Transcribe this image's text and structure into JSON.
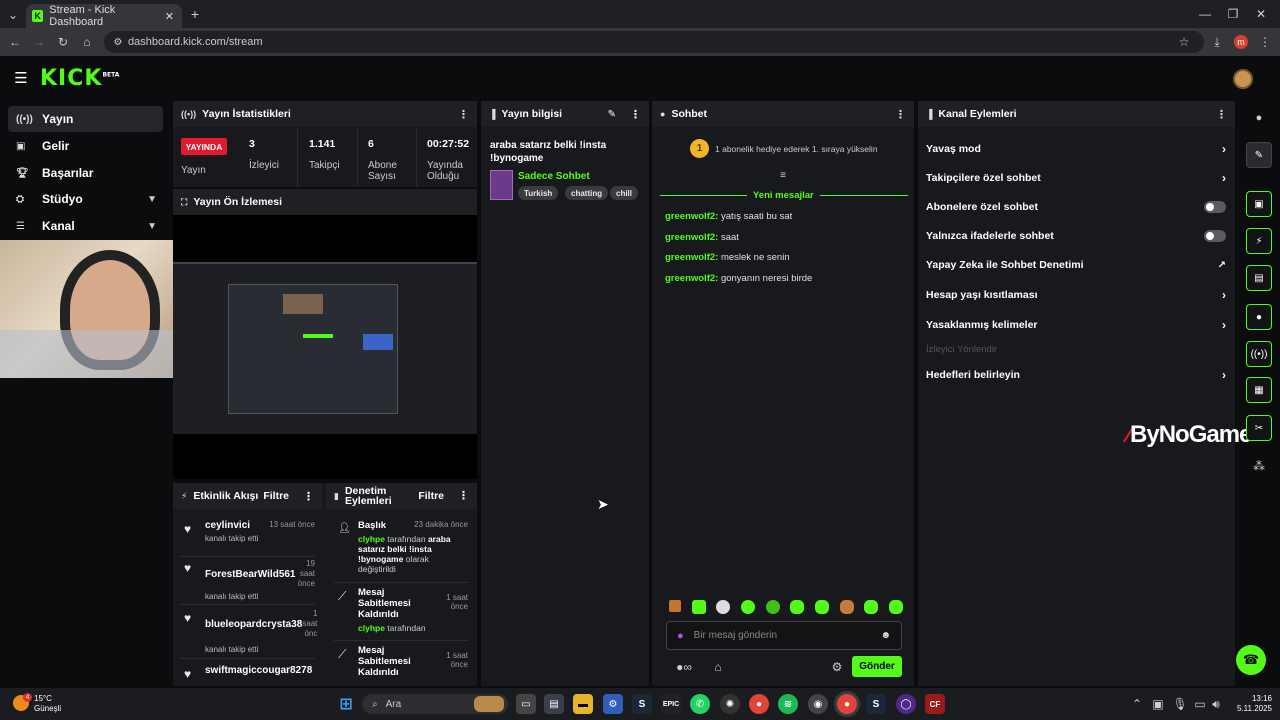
{
  "browser": {
    "tab_title": "Stream - Kick Dashboard",
    "url": "dashboard.kick.com/stream",
    "profile_initial": "m"
  },
  "header": {
    "logo": "KICK",
    "logo_badge": "BETA"
  },
  "sidebar": {
    "items": [
      {
        "label": "Yayın",
        "icon": "broadcast-icon"
      },
      {
        "label": "Gelir",
        "icon": "revenue-icon"
      },
      {
        "label": "Başarılar",
        "icon": "trophy-icon"
      },
      {
        "label": "Stüdyo",
        "icon": "studio-icon"
      },
      {
        "label": "Kanal",
        "icon": "channel-icon"
      }
    ]
  },
  "stats_panel": {
    "title": "Yayın İstatistikleri",
    "live_badge": "YAYINDA",
    "live_label": "Yayın",
    "stats": [
      {
        "value": "3",
        "label": "İzleyici"
      },
      {
        "value": "1.141",
        "label": "Takipçi"
      },
      {
        "value": "6",
        "label": "Abone Sayısı"
      },
      {
        "value": "00:27:52",
        "label": "Yayında Olduğu"
      }
    ]
  },
  "preview_panel": {
    "title": "Yayın Ön İzlemesi"
  },
  "info_panel": {
    "title": "Yayın bilgisi",
    "stream_title": "araba satarız belki !insta !bynogame",
    "category": "Sadece Sohbet",
    "tags": [
      "Turkish",
      "chatting",
      "chill"
    ]
  },
  "chat_panel": {
    "title": "Sohbet",
    "gift_badge": "1",
    "gift_text": "1 abonelik hediye ederek 1. sıraya yükselin",
    "new_messages": "Yeni mesajlar",
    "messages": [
      {
        "user": "greenwolf2:",
        "text": "yatış saati bu sat"
      },
      {
        "user": "greenwolf2:",
        "text": "saat"
      },
      {
        "user": "greenwolf2:",
        "text": "meslek ne senin"
      },
      {
        "user": "greenwolf2:",
        "text": "gonyanın neresi birde"
      }
    ],
    "input_placeholder": "Bir mesaj gönderin",
    "send_label": "Gönder"
  },
  "channel_actions": {
    "title": "Kanal Eylemleri",
    "items": [
      {
        "label": "Yavaş mod",
        "control": "arrow"
      },
      {
        "label": "Takipçilere özel sohbet",
        "control": "arrow"
      },
      {
        "label": "Abonelere özel sohbet",
        "control": "toggle"
      },
      {
        "label": "Yalnızca ifadelerle sohbet",
        "control": "toggle"
      },
      {
        "label": "Yapay Zeka ile Sohbet Denetimi",
        "control": "external"
      },
      {
        "label": "Hesap yaşı kısıtlaması",
        "control": "arrow"
      },
      {
        "label": "Yasaklanmış kelimeler",
        "control": "arrow"
      },
      {
        "label": "İzleyici Yönlendir",
        "control": "disabled"
      },
      {
        "label": "Hedefleri belirleyin",
        "control": "arrow"
      }
    ]
  },
  "activity_panel": {
    "title": "Etkinlik Akışı",
    "filter": "Filtre",
    "items": [
      {
        "name": "ceylinvici",
        "time": "13 saat önce",
        "sub": "kanalı takip etti"
      },
      {
        "name": "ForestBearWild561",
        "time": "19 saat önce",
        "sub": "kanalı takip etti"
      },
      {
        "name": "blueleopardcrysta38",
        "time": "1 saat önc",
        "sub": "kanalı takip etti"
      },
      {
        "name": "swiftmagiccougar8278",
        "time": "",
        "sub": ""
      }
    ]
  },
  "moderation_panel": {
    "title": "Denetim Eylemleri",
    "filter": "Filtre",
    "items": [
      {
        "title": "Başlık",
        "time": "23 dakika önce",
        "user": "clyhpe",
        "pre": " tarafından ",
        "bold": "araba satarız belki !insta !bynogame",
        "post": " olarak değiştirildi"
      },
      {
        "title": "Mesaj Sabitlemesi Kaldırıldı",
        "time": "1 saat önce",
        "user": "clyhpe",
        "pre": " tarafından"
      },
      {
        "title": "Mesaj Sabitlemesi Kaldırıldı",
        "time": "1 saat önce"
      }
    ]
  },
  "watermark": "ByNoGame",
  "taskbar": {
    "weather_temp": "15°C",
    "weather_text": "Güneşli",
    "weather_badge": "4",
    "search": "Ara",
    "time": "13:16",
    "date": "5.11.2025"
  },
  "colors": {
    "accent": "#53fc18",
    "live": "#e3192e",
    "panel": "#18191c"
  }
}
